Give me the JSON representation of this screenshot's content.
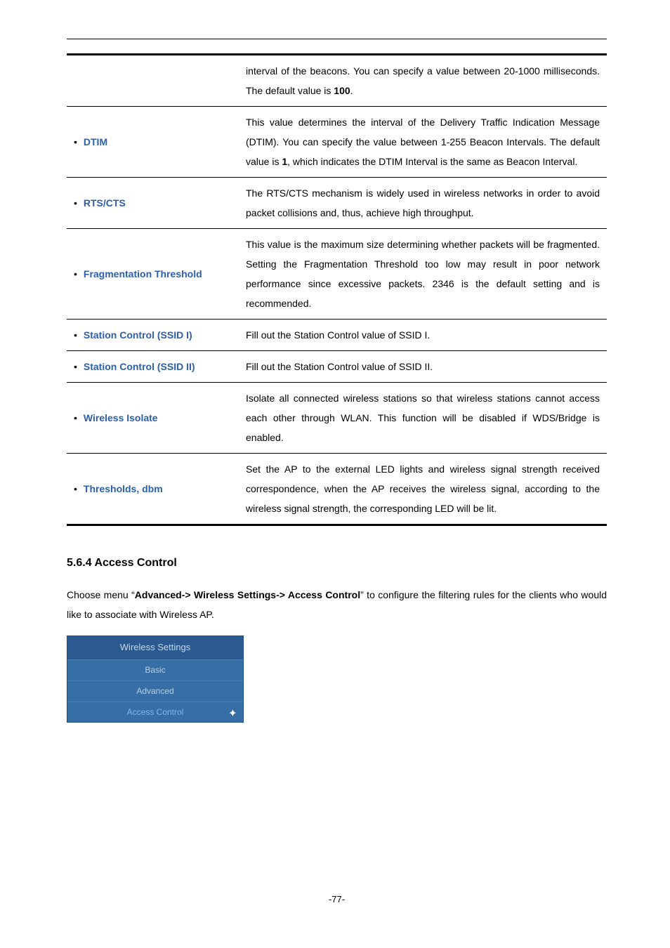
{
  "rows": [
    {
      "label": "",
      "labelName": "beacon-row",
      "text_pre": "interval of the beacons. You can specify a value between 20-1000 milliseconds. The default value is ",
      "bold": "100",
      "text_post": "."
    },
    {
      "label": "DTIM",
      "labelName": "dtim",
      "text_pre": "This value determines the interval of the Delivery Traffic Indication Message (DTIM). You can specify the value between 1-255 Beacon Intervals. The default value is ",
      "bold": "1",
      "text_post": ", which indicates the DTIM Interval is the same as Beacon Interval."
    },
    {
      "label": "RTS/CTS",
      "labelName": "rts-cts",
      "text_pre": "The RTS/CTS mechanism is widely used in wireless networks in order to avoid packet collisions and, thus, achieve high throughput.",
      "bold": "",
      "text_post": ""
    },
    {
      "label": "Fragmentation Threshold",
      "labelName": "fragmentation-threshold",
      "text_pre": "This value is the maximum size determining whether packets will be fragmented. Setting the Fragmentation Threshold too low may result in poor network performance since excessive packets. 2346 is the default setting and is recommended.",
      "bold": "",
      "text_post": ""
    },
    {
      "label": "Station Control (SSID I)",
      "labelName": "station-control-ssid-1",
      "text_pre": "Fill out the Station Control value of SSID I.",
      "bold": "",
      "text_post": ""
    },
    {
      "label": "Station Control (SSID II)",
      "labelName": "station-control-ssid-2",
      "text_pre": "Fill out the Station Control value of SSID II.",
      "bold": "",
      "text_post": ""
    },
    {
      "label": "Wireless Isolate",
      "labelName": "wireless-isolate",
      "text_pre": "Isolate all connected wireless stations so that wireless stations cannot access each other through WLAN. This function will be disabled if WDS/Bridge is enabled.",
      "bold": "",
      "text_post": ""
    },
    {
      "label": "Thresholds, dbm",
      "labelName": "thresholds-dbm",
      "text_pre": "Set the AP to the external LED lights and wireless signal strength received correspondence, when the AP receives the wireless signal, according to the wireless signal strength, the corresponding LED will be lit.",
      "bold": "",
      "text_post": ""
    }
  ],
  "section_title": "5.6.4  Access Control",
  "body_pre": "Choose menu “",
  "body_bold": "Advanced-> Wireless Settings-> Access Control",
  "body_post": "” to configure the filtering rules for the clients who would like to associate with Wireless AP.",
  "nav": {
    "header": "Wireless Settings",
    "items": [
      "Basic",
      "Advanced",
      "Access Control"
    ]
  },
  "page": "-77-"
}
